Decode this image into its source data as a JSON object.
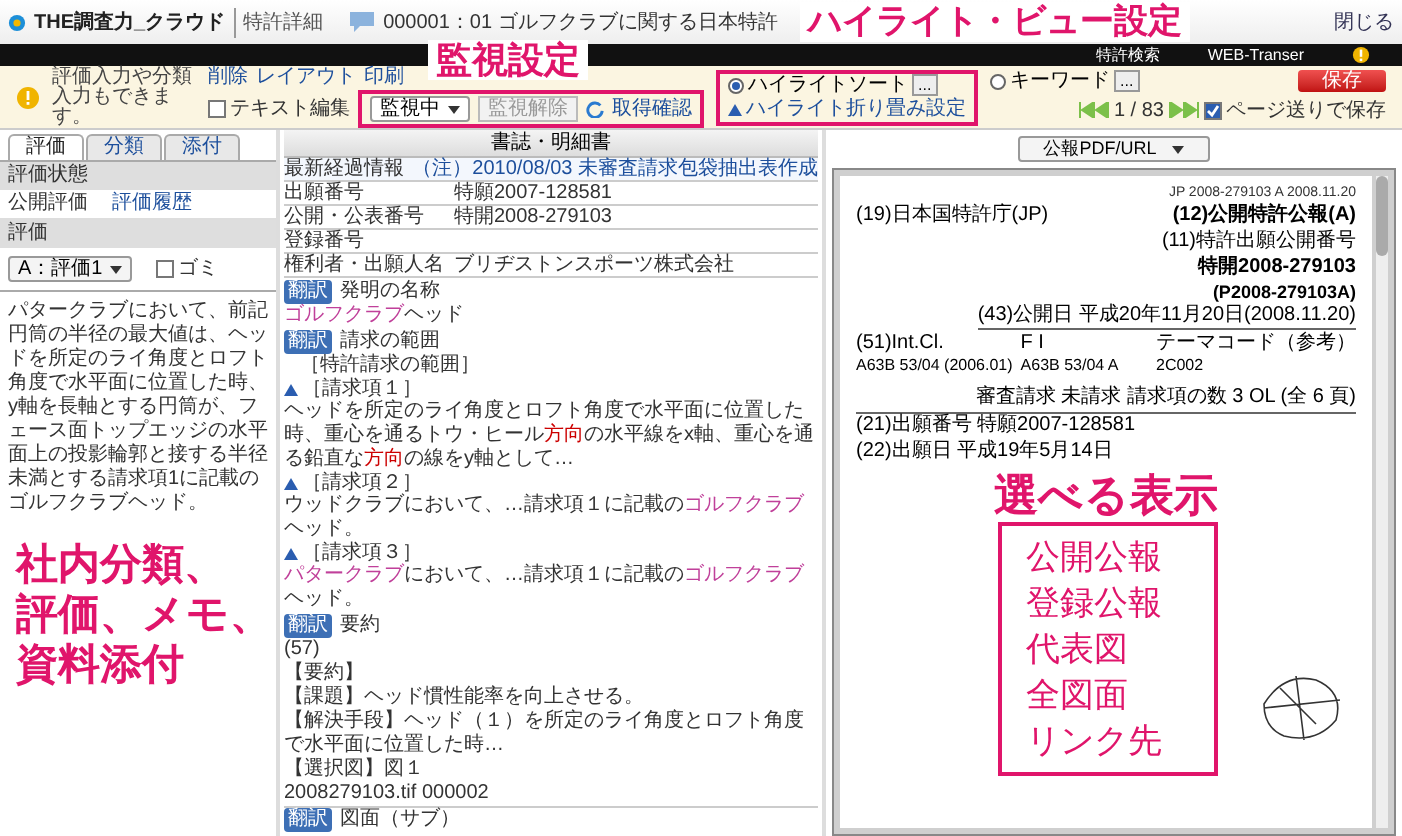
{
  "header": {
    "logo": "THE調査力_クラウド",
    "page_title": "特許詳細",
    "document": "000001：01 ゴルフクラブに関する日本特許",
    "close": "閉じる"
  },
  "nav_bar": {
    "items": [
      "特許検索",
      "WEB-Transer"
    ]
  },
  "toolbar": {
    "message": "評価入力や分類入力もできます。",
    "actions": [
      "削除",
      "レイアウト",
      "印刷"
    ],
    "text_edit": {
      "label": "テキスト編集",
      "checked": false
    },
    "watch_select": "監視中",
    "watch_cancel": {
      "label": "監視解除",
      "disabled": true
    },
    "fetch_check": "取得確認",
    "highlight_options": [
      {
        "label": "ハイライトソート",
        "selected": true,
        "button": "..."
      },
      {
        "label": "キーワード",
        "selected": false,
        "button": "..."
      }
    ],
    "fold_setting": "ハイライト折り畳み設定",
    "save_button": "保存",
    "pager": "1 / 83",
    "save_on_page": {
      "label": "ページ送りで保存",
      "checked": true
    }
  },
  "callout_watch": {
    "title": "監視設定"
  },
  "callout_highlight": {
    "title": "ハイライト・ビュー設定"
  },
  "left_panel": {
    "tabs": [
      {
        "label": "評価",
        "selected": true
      },
      {
        "label": "分類",
        "selected": false
      },
      {
        "label": "添付",
        "selected": false
      }
    ],
    "status_heading": "評価状態",
    "status_row": {
      "label": "公開評価",
      "link": "評価履歴"
    },
    "rating_heading": "評価",
    "rating_select": "A：評価1",
    "trash": {
      "label": "ゴミ",
      "checked": false
    },
    "memo": "パタークラブにおいて、前記円筒の半径の最大値は、ヘッドを所定のライ角度とロフト角度で水平面に位置した時、y軸を長軸とする円筒が、フェース面トップエッジの水平面上の投影輪郭と接する半径未満とする請求項1に記載のゴルフクラブヘッド。",
    "callout": {
      "lines": [
        "社内分類、",
        "評価、メモ、",
        "資料添付"
      ]
    }
  },
  "middle_panel": {
    "title": "書誌・明細書",
    "rows": [
      {
        "label": "最新経過情報",
        "value": "（注）2010/08/03 未審査請求包袋抽出表作成",
        "link": true
      },
      {
        "label": "出願番号",
        "value": "特願2007-128581",
        "link": false
      },
      {
        "label": "公開・公表番号",
        "value": "特開2008-279103",
        "link": false
      },
      {
        "label": "登録番号",
        "value": "",
        "link": false
      },
      {
        "label": "権利者・出願人名",
        "value": "ブリヂストンスポーツ株式会社",
        "link": false
      }
    ],
    "title_section": {
      "translate": "翻訳",
      "heading": "発明の名称",
      "parts": [
        {
          "text": "ゴルフクラブ",
          "color": "#c0409a"
        },
        {
          "text": "ヘッド"
        }
      ]
    },
    "claims_section": {
      "translate": "翻訳",
      "heading": "請求の範囲",
      "intro": "［特許請求の範囲］",
      "claims": [
        {
          "label": "［請求項１］",
          "parts": [
            {
              "text": "ヘッドを所定のライ角度とロフト角度で水平面に位置した時、重心を通るトウ・ヒール"
            },
            {
              "text": "方向",
              "color": "#cc0000"
            },
            {
              "text": "の水平線をx軸、重心を通る鉛直な"
            },
            {
              "text": "方向",
              "color": "#cc0000"
            },
            {
              "text": "の線をy軸として…"
            }
          ]
        },
        {
          "label": "［請求項２］",
          "parts": [
            {
              "text": "ウッドクラブにおいて、…請求項１に記載の"
            },
            {
              "text": "ゴルフクラブ",
              "color": "#c0409a"
            },
            {
              "text": "ヘッド。"
            }
          ]
        },
        {
          "label": "［請求項３］",
          "parts": [
            {
              "text": "パタークラブ",
              "color": "#c0409a"
            },
            {
              "text": "において、…請求項１に記載の"
            },
            {
              "text": "ゴルフクラブ",
              "color": "#c0409a"
            },
            {
              "text": "ヘッド。"
            }
          ]
        }
      ]
    },
    "abstract_section": {
      "translate": "翻訳",
      "heading": "要約",
      "lines": [
        {
          "parts": [
            {
              "text": "(57)"
            }
          ]
        },
        {
          "parts": [
            {
              "text": "【要約】"
            }
          ]
        },
        {
          "parts": [
            {
              "text": "【課題】ヘッド慣性能率を向上させる。"
            }
          ]
        },
        {
          "parts": [
            {
              "text": "【解決手段】ヘッド（１）を所定のライ角度とロフト角度で水平面に位置した時…"
            }
          ]
        },
        {
          "parts": [
            {
              "text": "【選択図】図１"
            }
          ]
        },
        {
          "parts": [
            {
              "text": "2008279103.tif 000002"
            }
          ]
        }
      ]
    },
    "drawings_section": {
      "translate": "翻訳",
      "heading": "図面（サブ）"
    }
  },
  "right_panel": {
    "view_select": "公報PDF/URL",
    "document": {
      "stamp": "JP 2008-279103 A 2008.11.20",
      "office": "(19)日本国特許庁(JP)",
      "kind": "(12)公開特許公報(A)",
      "number_label": "(11)特許出願公開番号",
      "number": "特開2008-279103",
      "number_alt": "(P2008-279103A)",
      "published": "(43)公開日 平成20年11月20日(2008.11.20)",
      "class_columns": [
        "(51)Int.Cl.",
        "F I",
        "テーマコード（参考）"
      ],
      "class_values": [
        "A63B 53/04 (2006.01)",
        "A63B 53/04 A",
        "2C002"
      ],
      "exam": "審査請求 未請求 請求項の数 3 OL (全 6 頁)",
      "app_no": "(21)出願番号 特願2007-128581",
      "app_date": "(22)出願日 平成19年5月14日"
    },
    "callout": {
      "title": "選べる表示",
      "items": [
        "公開公報",
        "登録公報",
        "代表図",
        "全図面",
        "リンク先"
      ]
    }
  }
}
